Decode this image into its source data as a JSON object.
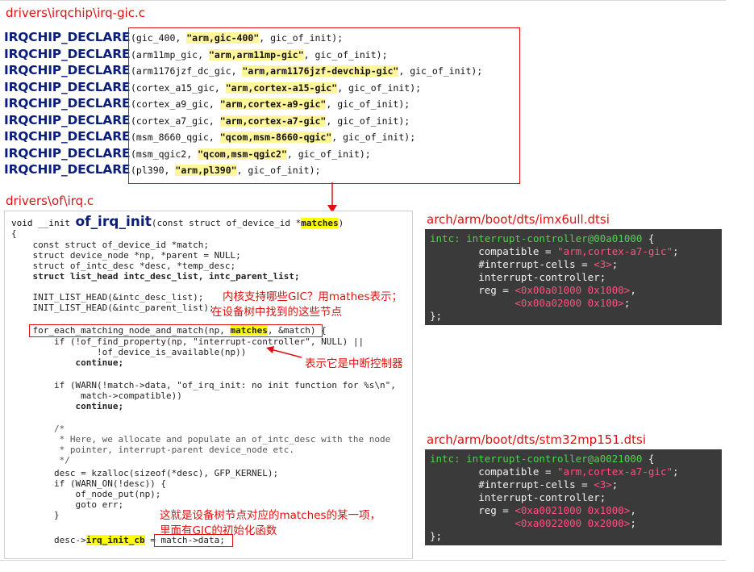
{
  "header1": "drivers\\irqchip\\irq-gic.c",
  "header2": "drivers\\of\\irq.c",
  "dts_header1": "arch/arm/boot/dts/imx6ull.dtsi",
  "dts_header2": "arch/arm/boot/dts/stm32mp151.dtsi",
  "irqchip": {
    "keyword": "IRQCHIP_DECLARE",
    "lines": [
      {
        "name": "(gic_400, ",
        "compat": "\"arm,gic-400\"",
        "tail": ", gic_of_init);"
      },
      {
        "name": "(arm11mp_gic, ",
        "compat": "\"arm,arm11mp-gic\"",
        "tail": ", gic_of_init);"
      },
      {
        "name": "(arm1176jzf_dc_gic, ",
        "compat": "\"arm,arm1176jzf-devchip-gic\"",
        "tail": ", gic_of_init);"
      },
      {
        "name": "(cortex_a15_gic, ",
        "compat": "\"arm,cortex-a15-gic\"",
        "tail": ", gic_of_init);"
      },
      {
        "name": "(cortex_a9_gic, ",
        "compat": "\"arm,cortex-a9-gic\"",
        "tail": ", gic_of_init);"
      },
      {
        "name": "(cortex_a7_gic, ",
        "compat": "\"arm,cortex-a7-gic\"",
        "tail": ", gic_of_init);"
      },
      {
        "name": "(msm_8660_qgic, ",
        "compat": "\"qcom,msm-8660-qgic\"",
        "tail": ", gic_of_init);"
      },
      {
        "name": "(msm_qgic2, ",
        "compat": "\"qcom,msm-qgic2\"",
        "tail": ", gic_of_init);"
      },
      {
        "name": "(pl390, ",
        "compat": "\"arm,pl390\"",
        "tail": ", gic_of_init);"
      }
    ]
  },
  "code": {
    "sig_pre": "void __init ",
    "sig_fn": "of_irq_init",
    "sig_mid": "(const struct of_device_id *",
    "sig_hl": "matches",
    "sig_end": ")",
    "l_brace": "{",
    "l1": "    const struct of_device_id *match;",
    "l2": "    struct device_node *np, *parent = NULL;",
    "l3": "    struct of_intc_desc *desc, *temp_desc;",
    "l4": "    struct list_head intc_desc_list, intc_parent_list;",
    "l5": "    INIT_LIST_HEAD(&intc_desc_list);",
    "l6": "    INIT_LIST_HEAD(&intc_parent_list);",
    "l7_pre": "    for_each_matching_node_and_match(np, ",
    "l7_hl": "matches",
    "l7_end": ", &match)",
    "l7_tail": " {",
    "l8": "        if (!of_find_property(np, \"interrupt-controller\", NULL) ||",
    "l9": "                !of_device_is_available(np))",
    "l10": "            continue;",
    "l11": "        if (WARN(!match->data, \"of_irq_init: no init function for %s\\n\",",
    "l12": "             match->compatible))",
    "l13": "            continue;",
    "l14": "        /*",
    "l15": "         * Here, we allocate and populate an of_intc_desc with the node",
    "l16": "         * pointer, interrupt-parent device_node etc.",
    "l17": "         */",
    "l18": "        desc = kzalloc(sizeof(*desc), GFP_KERNEL);",
    "l19": "        if (WARN_ON(!desc)) {",
    "l20": "            of_node_put(np);",
    "l21": "            goto err;",
    "l22": "        }",
    "l23_pre": "        desc->",
    "l23_hl": "irq_init_cb",
    "l23_mid": " = ",
    "l23_box": "match->data;"
  },
  "annotations": {
    "a1": "内核支持哪些GIC？用mathes表示；",
    "a2": "在设备树中找到的这些节点",
    "a3": "表示它是中断控制器",
    "a4": "这就是设备树节点对应的matches的某一项，",
    "a5": "里面有GIC的初始化函数"
  },
  "dts1": {
    "l1_a": "intc: ",
    "l1_b": "interrupt-controller@00a01000",
    "l1_c": " {",
    "l2_a": "        compatible = ",
    "l2_b": "\"arm,cortex-a7-gic\"",
    "l2_c": ";",
    "l3_a": "        #interrupt-cells = ",
    "l3_b": "<3>",
    "l3_c": ";",
    "l4": "        interrupt-controller;",
    "l5_a": "        reg = ",
    "l5_b": "<0x00a01000 0x1000>",
    "l5_c": ",",
    "l6_a": "              ",
    "l6_b": "<0x00a02000 0x100>",
    "l6_c": ";",
    "l7": "};"
  },
  "dts2": {
    "l1_a": "intc: ",
    "l1_b": "interrupt-controller@a0021000",
    "l1_c": " {",
    "l2_a": "        compatible = ",
    "l2_b": "\"arm,cortex-a7-gic\"",
    "l2_c": ";",
    "l3_a": "        #interrupt-cells = ",
    "l3_b": "<3>",
    "l3_c": ";",
    "l4": "        interrupt-controller;",
    "l5_a": "        reg = ",
    "l5_b": "<0xa0021000 0x1000>",
    "l5_c": ",",
    "l6_a": "              ",
    "l6_b": "<0xa0022000 0x2000>",
    "l6_c": ";",
    "l7": "};"
  }
}
